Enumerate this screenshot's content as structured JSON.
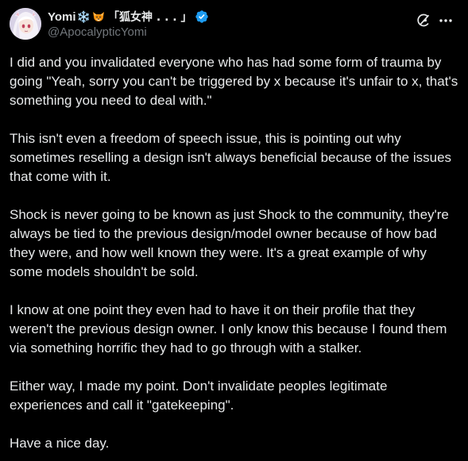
{
  "author": {
    "display_name": "Yomi",
    "name_suffix": "「狐女神 . . . 」",
    "handle": "@ApocalypticYomi",
    "avatar_icon": "anime-avatar-icon",
    "verified_color": "#1d9bf0"
  },
  "header_actions": {
    "grok_icon": "grok-icon",
    "more_icon": "more-options-icon"
  },
  "post": {
    "paragraphs": [
      "I did and you invalidated everyone who has had some form of trauma by going \"Yeah, sorry you can't be triggered by x because it's unfair to x, that's something you need to deal with.\"",
      "This isn't even a freedom of speech issue, this is pointing out why sometimes reselling a design isn't always beneficial because of the issues that come with it.",
      "Shock is never going to be known as just Shock to the community, they're always be tied to the previous design/model owner because of how bad they were, and how well known they were. It's a great example of why some models shouldn't be sold.",
      "I know at one point they even had to have it on their profile that they weren't the previous design owner. I only know this because I found them via something horrific they had to go through with a stalker.",
      "Either way, I made my point. Don't invalidate peoples legitimate experiences and call it \"gatekeeping\".",
      "Have a nice day."
    ]
  },
  "colors": {
    "background": "#000000",
    "text": "#e7e9ea",
    "secondary_text": "#71767b",
    "accent": "#1d9bf0"
  }
}
